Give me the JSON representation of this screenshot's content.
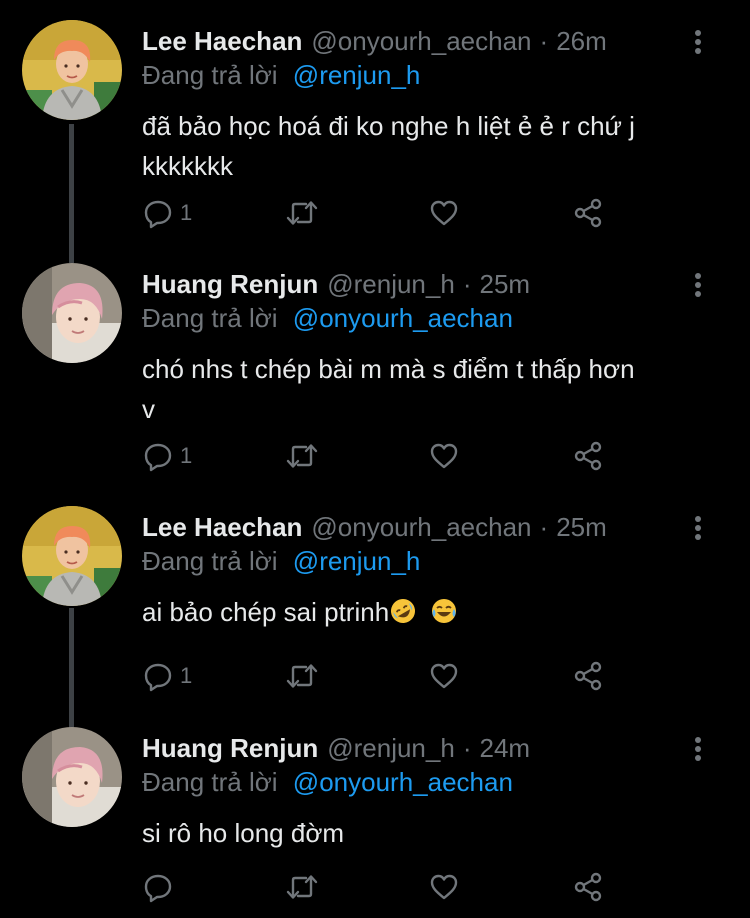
{
  "colors": {
    "background": "#000000",
    "text": "#e7e9ea",
    "muted": "#71767b",
    "link": "#1d9bf0",
    "thread_line": "#3d4145"
  },
  "tweets": [
    {
      "display_name": "Lee Haechan",
      "handle": "@onyourh_aechan",
      "separator": "·",
      "time": "26m",
      "reply_label": "Đang trả lời",
      "reply_to": "@renjun_h",
      "text_line1": "đã bảo học hoá đi ko nghe h liệt ẻ ẻ r chứ j",
      "text_line2": "kkkkkkk",
      "reply_count": "1",
      "avatar": "avatar-haechan"
    },
    {
      "display_name": "Huang Renjun",
      "handle": "@renjun_h",
      "separator": "·",
      "time": "25m",
      "reply_label": "Đang trả lời",
      "reply_to": "@onyourh_aechan",
      "text_line1": "chó nhs t chép bài m mà s điểm t thấp hơn",
      "text_line2": "v",
      "reply_count": "1",
      "avatar": "avatar-renjun"
    },
    {
      "display_name": "Lee Haechan",
      "handle": "@onyourh_aechan",
      "separator": "·",
      "time": "25m",
      "reply_label": "Đang trả lời",
      "reply_to": "@renjun_h",
      "text_line1": "ai bảo chép sai ptrinh",
      "emojis": [
        "rolling-on-floor-laughing-emoji",
        "tears-of-joy-emoji"
      ],
      "reply_count": "1",
      "avatar": "avatar-haechan"
    },
    {
      "display_name": "Huang Renjun",
      "handle": "@renjun_h",
      "separator": "·",
      "time": "24m",
      "reply_label": "Đang trả lời",
      "reply_to": "@onyourh_aechan",
      "text_line1": "si rô ho long đờm",
      "reply_count": "",
      "avatar": "avatar-renjun"
    }
  ],
  "icons": {
    "reply": "reply-icon",
    "retweet": "retweet-icon",
    "like": "heart-icon",
    "share": "share-icon",
    "more": "more-vertical-icon"
  }
}
